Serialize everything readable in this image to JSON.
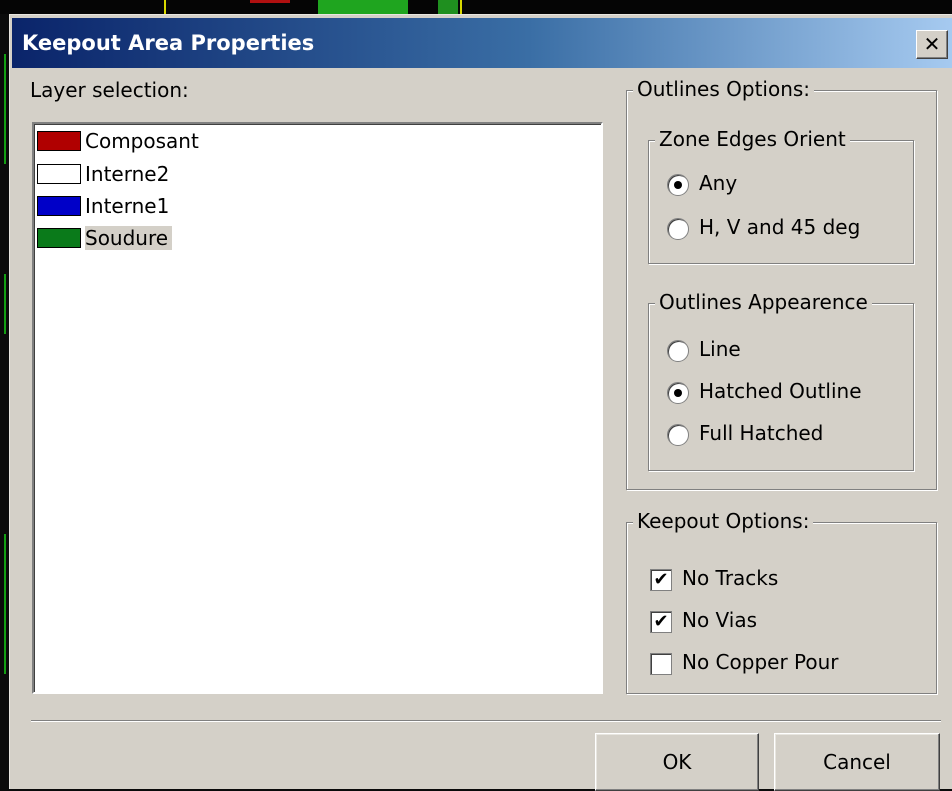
{
  "window": {
    "title": "Keepout Area Properties",
    "close_symbol": "✕"
  },
  "layer_selection": {
    "label": "Layer selection:",
    "items": [
      {
        "label": "Composant",
        "color": "#b00000",
        "selected": false
      },
      {
        "label": "Interne2",
        "color": "#ffffff",
        "selected": false
      },
      {
        "label": "Interne1",
        "color": "#0000c8",
        "selected": false
      },
      {
        "label": "Soudure",
        "color": "#0a7a1a",
        "selected": true
      }
    ]
  },
  "outlines_options": {
    "label": "Outlines Options:",
    "zone_edges_orient": {
      "label": "Zone Edges Orient",
      "options": [
        {
          "label": "Any",
          "checked": true
        },
        {
          "label": "H, V and 45 deg",
          "checked": false
        }
      ]
    },
    "outlines_appearence": {
      "label": "Outlines Appearence",
      "options": [
        {
          "label": "Line",
          "checked": false
        },
        {
          "label": "Hatched Outline",
          "checked": true
        },
        {
          "label": "Full Hatched",
          "checked": false
        }
      ]
    }
  },
  "keepout_options": {
    "label": "Keepout Options:",
    "items": [
      {
        "label": "No Tracks",
        "checked": true
      },
      {
        "label": "No Vias",
        "checked": true
      },
      {
        "label": "No Copper Pour",
        "checked": false
      }
    ]
  },
  "buttons": {
    "ok": "OK",
    "cancel": "Cancel"
  }
}
